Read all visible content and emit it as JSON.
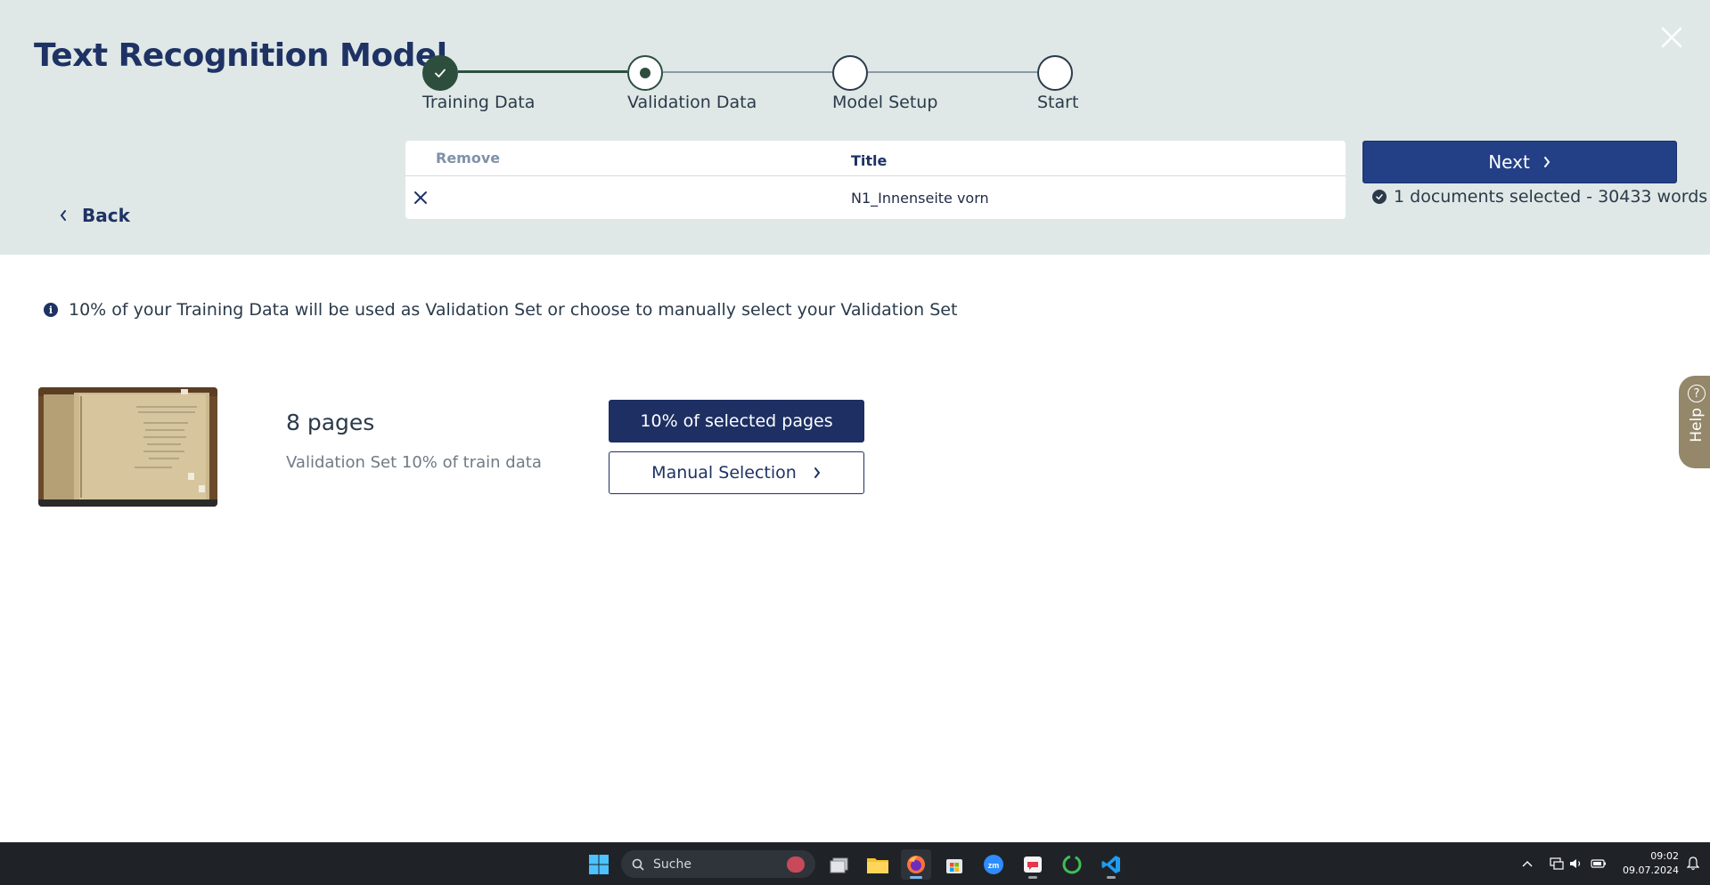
{
  "header": {
    "title": "Text Recognition Model",
    "close_icon": "close-icon"
  },
  "stepper": {
    "steps": [
      {
        "label": "Training Data",
        "state": "completed"
      },
      {
        "label": "Validation Data",
        "state": "current"
      },
      {
        "label": "Model Setup",
        "state": "pending"
      },
      {
        "label": "Start",
        "state": "pending"
      }
    ]
  },
  "nav": {
    "back_label": "Back",
    "next_label": "Next"
  },
  "documents_table": {
    "columns": [
      "Remove",
      "Title"
    ],
    "rows": [
      {
        "title": "N1_Innenseite vorn"
      }
    ]
  },
  "selection_info": "1 documents selected - 30433 words",
  "info_message": "10% of your Training Data will be used as Validation Set or choose to manually select your Validation Set",
  "validation": {
    "pages_count": "8 pages",
    "subtitle": "Validation Set 10% of train data",
    "option_primary": "10% of selected pages",
    "option_secondary": "Manual Selection"
  },
  "help": {
    "label": "Help"
  },
  "taskbar": {
    "search_placeholder": "Suche",
    "time": "09:02",
    "date": "09.07.2024"
  },
  "colors": {
    "panel_bg": "#dfe8e6",
    "primary": "#233f86",
    "stepper_done": "#2d4e3d",
    "help_tab": "#94876a"
  }
}
